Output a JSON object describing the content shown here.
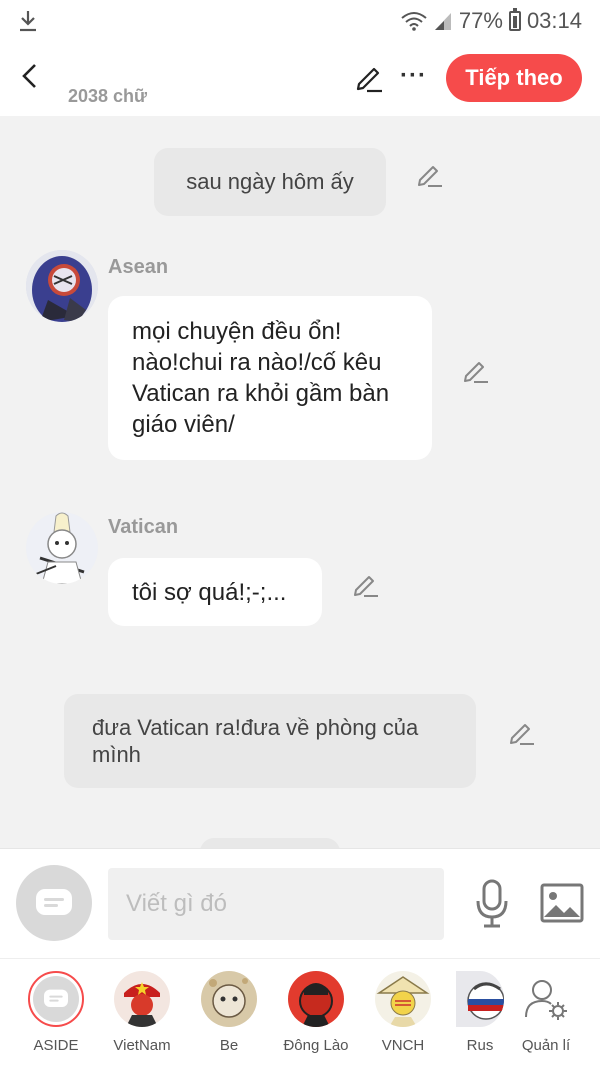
{
  "status_bar": {
    "battery": "77%",
    "time": "03:14"
  },
  "header": {
    "word_count": "2038 chữ",
    "next_label": "Tiếp theo",
    "more": "···"
  },
  "messages": {
    "narration1": "sau ngày hôm ấy",
    "asean_name": "Asean",
    "asean_text": "mọi chuyện đều ổn! nào!chui ra nào!/cố kêu Vatican ra khỏi gầm bàn giáo viên/",
    "vatican_name": "Vatican",
    "vatican_text": "tôi sợ quá!;-;...",
    "narration2": "đưa Vatican ra!đưa về phòng của mình"
  },
  "input": {
    "placeholder": "Viết gì đó"
  },
  "characters": [
    {
      "label": "ASIDE"
    },
    {
      "label": "VietNam"
    },
    {
      "label": "Be"
    },
    {
      "label": "Đông Lào"
    },
    {
      "label": "VNCH"
    },
    {
      "label": "Rus"
    },
    {
      "label": "Quản lí"
    }
  ],
  "colors": {
    "accent": "#f64b4b",
    "background": "#f2f2f2",
    "narration_bg": "#e8e8e8"
  }
}
